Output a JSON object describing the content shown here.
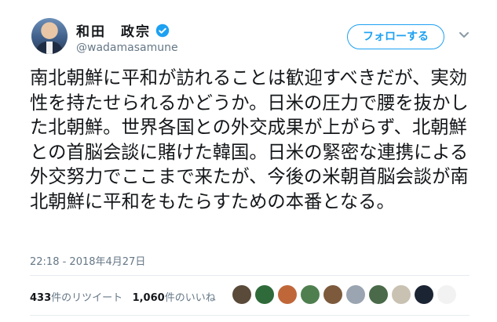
{
  "author": {
    "display_name": "和田　政宗",
    "handle": "@wadamasamune",
    "verified_icon": "verified-badge-icon"
  },
  "follow_button": {
    "label": "フォローする"
  },
  "menu_icon": "chevron-down-icon",
  "tweet": {
    "text": "南北朝鮮に平和が訪れることは歓迎すべきだが、実効性を持たせられるかどうか。日米の圧力で腰を抜かした北朝鮮。世界各国との外交成果が上がらず、北朝鮮との首脳会談に賭けた韓国。日米の緊密な連携による外交努力でここまで来たが、今後の米朝首脳会談が南北朝鮮に平和をもたらすための本番となる。",
    "timestamp": "22:18 - 2018年4月27日"
  },
  "stats": {
    "retweets_count": "433",
    "retweets_label": "件のリツイート",
    "likes_count": "1,060",
    "likes_label": "件のいいね"
  },
  "likers": [
    {
      "color": "#5a4a3a"
    },
    {
      "color": "#2f6b3a"
    },
    {
      "color": "#c0673a"
    },
    {
      "color": "#4f7f4f"
    },
    {
      "color": "#7d5a3c"
    },
    {
      "color": "#9aa5b1"
    },
    {
      "color": "#4a6a4a"
    },
    {
      "color": "#c9c2b3"
    },
    {
      "color": "#1b2433"
    },
    {
      "color": "#f2f2f2"
    }
  ],
  "colors": {
    "accent": "#1da1f2",
    "secondary_text": "#657786",
    "divider": "#e6ecf0"
  }
}
